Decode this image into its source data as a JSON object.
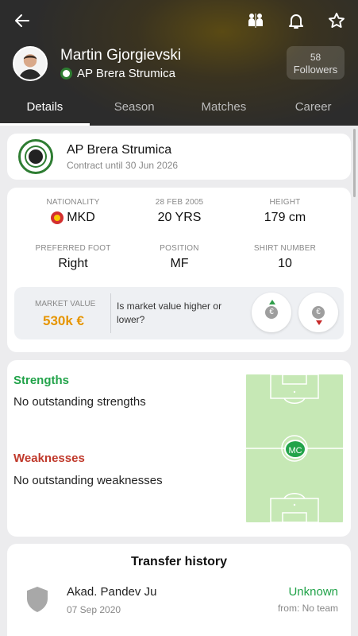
{
  "header": {
    "player_name": "Martin Gjorgievski",
    "club": "AP Brera Strumica",
    "followers_count": "58",
    "followers_label": "Followers",
    "icons": [
      "back-arrow-icon",
      "compare-players-icon",
      "bell-icon",
      "star-icon"
    ]
  },
  "tabs": [
    {
      "label": "Details",
      "active": true
    },
    {
      "label": "Season",
      "active": false
    },
    {
      "label": "Matches",
      "active": false
    },
    {
      "label": "Career",
      "active": false
    }
  ],
  "club_card": {
    "name": "AP Brera Strumica",
    "contract": "Contract until 30 Jun 2026"
  },
  "info": {
    "nationality_label": "NATIONALITY",
    "nationality_value": "MKD",
    "dob_label": "28 FEB 2005",
    "age_value": "20 YRS",
    "height_label": "HEIGHT",
    "height_value": "179 cm",
    "foot_label": "PREFERRED FOOT",
    "foot_value": "Right",
    "position_label": "POSITION",
    "position_value": "MF",
    "shirt_label": "SHIRT NUMBER",
    "shirt_value": "10"
  },
  "market_value": {
    "label": "MARKET VALUE",
    "value": "530k €",
    "question": "Is market value higher or lower?",
    "coin_symbol": "€"
  },
  "strengths": {
    "title": "Strengths",
    "text": "No outstanding strengths",
    "title_color": "#22a34a"
  },
  "weaknesses": {
    "title": "Weaknesses",
    "text": "No outstanding weaknesses",
    "title_color": "#c0392b"
  },
  "pitch": {
    "position_badge": "MC"
  },
  "transfer_history": {
    "title": "Transfer history",
    "items": [
      {
        "club": "Akad. Pandev Ju",
        "date": "07 Sep 2020",
        "fee": "Unknown",
        "from": "from: No team"
      }
    ]
  },
  "colors": {
    "accent_green": "#22a34a",
    "market_value_orange": "#e69500",
    "weakness_red": "#c0392b"
  }
}
